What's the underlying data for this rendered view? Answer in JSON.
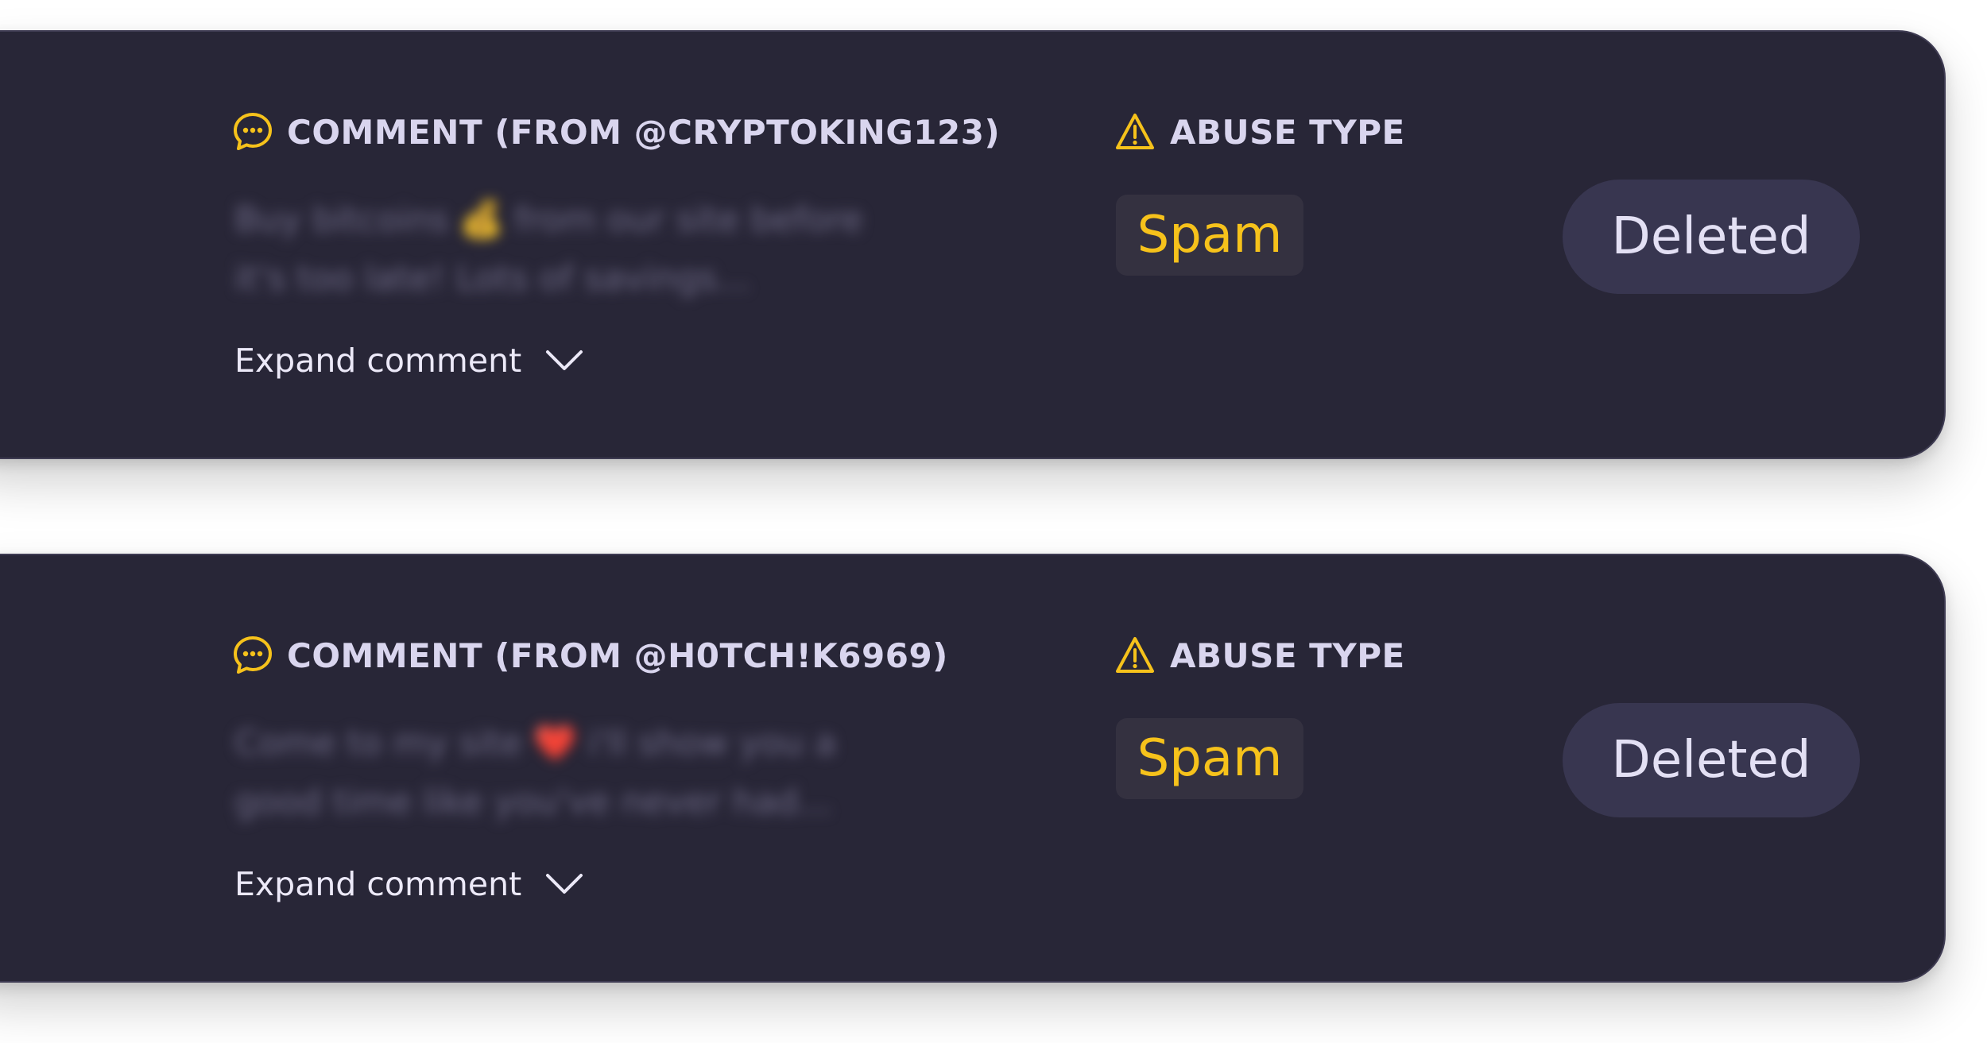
{
  "colors": {
    "card_bg": "#282637",
    "accent_yellow": "#f6c21b",
    "header_text": "#d9d5ee",
    "pill_bg": "#383650",
    "badge_bg": "#343140"
  },
  "icons": {
    "comment": "speech-bubble-dots-icon",
    "warning": "warning-triangle-icon",
    "expand": "chevron-down-icon"
  },
  "comments": [
    {
      "header": "COMMENT (FROM @CRYPTOKING123)",
      "text": "Buy bitcoins 💰 from our site before\nit's too late! Lots of savings...",
      "expand_label": "Expand comment",
      "abuse_label": "ABUSE TYPE",
      "abuse_type": "Spam",
      "status": "Deleted"
    },
    {
      "header": "COMMENT (FROM @H0TCH!K6969)",
      "text": "Come to my site ❤️ i'll show you a\ngood time like you've never had...",
      "expand_label": "Expand comment",
      "abuse_label": "ABUSE TYPE",
      "abuse_type": "Spam",
      "status": "Deleted"
    }
  ]
}
